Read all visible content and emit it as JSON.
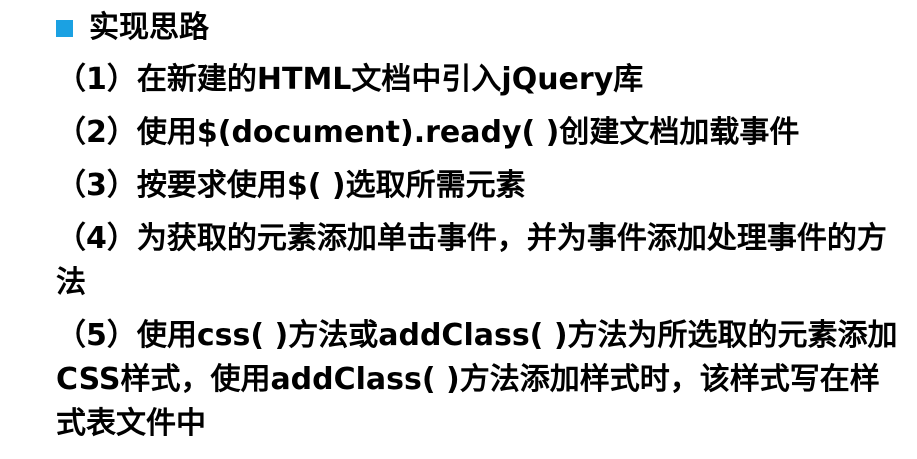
{
  "heading": {
    "bullet_color": "#1ba1e2",
    "text": "实现思路"
  },
  "steps": [
    {
      "number": "（1）",
      "text": "在新建的HTML文档中引入jQuery库"
    },
    {
      "number": "（2）",
      "text": "使用$(document).ready( )创建文档加载事件"
    },
    {
      "number": "（3）",
      "text": "按要求使用$( )选取所需元素"
    },
    {
      "number": "（4）",
      "text": "为获取的元素添加单击事件，并为事件添加处理事件的方法"
    },
    {
      "number": "（5）",
      "text": "使用css( )方法或addClass( )方法为所选取的元素添加CSS样式，使用addClass( )方法添加样式时，该样式写在样式表文件中"
    }
  ]
}
